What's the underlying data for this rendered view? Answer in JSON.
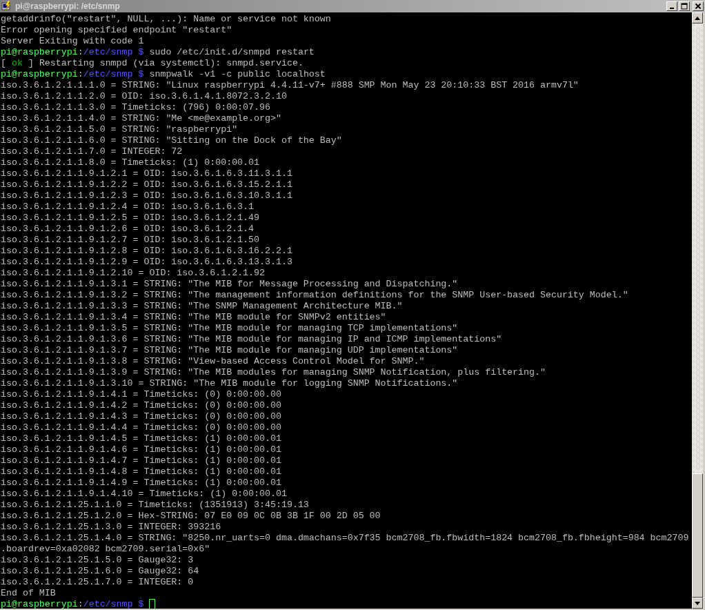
{
  "window": {
    "title": "pi@raspberrypi: /etc/snmp"
  },
  "lines": [
    {
      "segments": [
        {
          "kind": "text",
          "text": "getaddrinfo(\"restart\", NULL, ...): Name or service not known"
        }
      ]
    },
    {
      "segments": [
        {
          "kind": "text",
          "text": "Error opening specified endpoint \"restart\""
        }
      ]
    },
    {
      "segments": [
        {
          "kind": "text",
          "text": "Server Exiting with code 1"
        }
      ]
    },
    {
      "segments": [
        {
          "kind": "user",
          "text": "pi@raspberrypi"
        },
        {
          "kind": "text",
          "text": ":"
        },
        {
          "kind": "path",
          "text": "/etc/snmp $"
        },
        {
          "kind": "text",
          "text": " sudo /etc/init.d/snmpd restart"
        }
      ]
    },
    {
      "segments": [
        {
          "kind": "text",
          "text": "[ "
        },
        {
          "kind": "ok",
          "text": "ok"
        },
        {
          "kind": "text",
          "text": " ] Restarting snmpd (via systemctl): snmpd.service."
        }
      ]
    },
    {
      "segments": [
        {
          "kind": "user",
          "text": "pi@raspberrypi"
        },
        {
          "kind": "text",
          "text": ":"
        },
        {
          "kind": "path",
          "text": "/etc/snmp $"
        },
        {
          "kind": "text",
          "text": " snmpwalk -v1 -c public localhost"
        }
      ]
    },
    {
      "segments": [
        {
          "kind": "text",
          "text": "iso.3.6.1.2.1.1.1.0 = STRING: \"Linux raspberrypi 4.4.11-v7+ #888 SMP Mon May 23 20:10:33 BST 2016 armv7l\""
        }
      ]
    },
    {
      "segments": [
        {
          "kind": "text",
          "text": "iso.3.6.1.2.1.1.2.0 = OID: iso.3.6.1.4.1.8072.3.2.10"
        }
      ]
    },
    {
      "segments": [
        {
          "kind": "text",
          "text": "iso.3.6.1.2.1.1.3.0 = Timeticks: (796) 0:00:07.96"
        }
      ]
    },
    {
      "segments": [
        {
          "kind": "text",
          "text": "iso.3.6.1.2.1.1.4.0 = STRING: \"Me <me@example.org>\""
        }
      ]
    },
    {
      "segments": [
        {
          "kind": "text",
          "text": "iso.3.6.1.2.1.1.5.0 = STRING: \"raspberrypi\""
        }
      ]
    },
    {
      "segments": [
        {
          "kind": "text",
          "text": "iso.3.6.1.2.1.1.6.0 = STRING: \"Sitting on the Dock of the Bay\""
        }
      ]
    },
    {
      "segments": [
        {
          "kind": "text",
          "text": "iso.3.6.1.2.1.1.7.0 = INTEGER: 72"
        }
      ]
    },
    {
      "segments": [
        {
          "kind": "text",
          "text": "iso.3.6.1.2.1.1.8.0 = Timeticks: (1) 0:00:00.01"
        }
      ]
    },
    {
      "segments": [
        {
          "kind": "text",
          "text": "iso.3.6.1.2.1.1.9.1.2.1 = OID: iso.3.6.1.6.3.11.3.1.1"
        }
      ]
    },
    {
      "segments": [
        {
          "kind": "text",
          "text": "iso.3.6.1.2.1.1.9.1.2.2 = OID: iso.3.6.1.6.3.15.2.1.1"
        }
      ]
    },
    {
      "segments": [
        {
          "kind": "text",
          "text": "iso.3.6.1.2.1.1.9.1.2.3 = OID: iso.3.6.1.6.3.10.3.1.1"
        }
      ]
    },
    {
      "segments": [
        {
          "kind": "text",
          "text": "iso.3.6.1.2.1.1.9.1.2.4 = OID: iso.3.6.1.6.3.1"
        }
      ]
    },
    {
      "segments": [
        {
          "kind": "text",
          "text": "iso.3.6.1.2.1.1.9.1.2.5 = OID: iso.3.6.1.2.1.49"
        }
      ]
    },
    {
      "segments": [
        {
          "kind": "text",
          "text": "iso.3.6.1.2.1.1.9.1.2.6 = OID: iso.3.6.1.2.1.4"
        }
      ]
    },
    {
      "segments": [
        {
          "kind": "text",
          "text": "iso.3.6.1.2.1.1.9.1.2.7 = OID: iso.3.6.1.2.1.50"
        }
      ]
    },
    {
      "segments": [
        {
          "kind": "text",
          "text": "iso.3.6.1.2.1.1.9.1.2.8 = OID: iso.3.6.1.6.3.16.2.2.1"
        }
      ]
    },
    {
      "segments": [
        {
          "kind": "text",
          "text": "iso.3.6.1.2.1.1.9.1.2.9 = OID: iso.3.6.1.6.3.13.3.1.3"
        }
      ]
    },
    {
      "segments": [
        {
          "kind": "text",
          "text": "iso.3.6.1.2.1.1.9.1.2.10 = OID: iso.3.6.1.2.1.92"
        }
      ]
    },
    {
      "segments": [
        {
          "kind": "text",
          "text": "iso.3.6.1.2.1.1.9.1.3.1 = STRING: \"The MIB for Message Processing and Dispatching.\""
        }
      ]
    },
    {
      "segments": [
        {
          "kind": "text",
          "text": "iso.3.6.1.2.1.1.9.1.3.2 = STRING: \"The management information definitions for the SNMP User-based Security Model.\""
        }
      ]
    },
    {
      "segments": [
        {
          "kind": "text",
          "text": "iso.3.6.1.2.1.1.9.1.3.3 = STRING: \"The SNMP Management Architecture MIB.\""
        }
      ]
    },
    {
      "segments": [
        {
          "kind": "text",
          "text": "iso.3.6.1.2.1.1.9.1.3.4 = STRING: \"The MIB module for SNMPv2 entities\""
        }
      ]
    },
    {
      "segments": [
        {
          "kind": "text",
          "text": "iso.3.6.1.2.1.1.9.1.3.5 = STRING: \"The MIB module for managing TCP implementations\""
        }
      ]
    },
    {
      "segments": [
        {
          "kind": "text",
          "text": "iso.3.6.1.2.1.1.9.1.3.6 = STRING: \"The MIB module for managing IP and ICMP implementations\""
        }
      ]
    },
    {
      "segments": [
        {
          "kind": "text",
          "text": "iso.3.6.1.2.1.1.9.1.3.7 = STRING: \"The MIB module for managing UDP implementations\""
        }
      ]
    },
    {
      "segments": [
        {
          "kind": "text",
          "text": "iso.3.6.1.2.1.1.9.1.3.8 = STRING: \"View-based Access Control Model for SNMP.\""
        }
      ]
    },
    {
      "segments": [
        {
          "kind": "text",
          "text": "iso.3.6.1.2.1.1.9.1.3.9 = STRING: \"The MIB modules for managing SNMP Notification, plus filtering.\""
        }
      ]
    },
    {
      "segments": [
        {
          "kind": "text",
          "text": "iso.3.6.1.2.1.1.9.1.3.10 = STRING: \"The MIB module for logging SNMP Notifications.\""
        }
      ]
    },
    {
      "segments": [
        {
          "kind": "text",
          "text": "iso.3.6.1.2.1.1.9.1.4.1 = Timeticks: (0) 0:00:00.00"
        }
      ]
    },
    {
      "segments": [
        {
          "kind": "text",
          "text": "iso.3.6.1.2.1.1.9.1.4.2 = Timeticks: (0) 0:00:00.00"
        }
      ]
    },
    {
      "segments": [
        {
          "kind": "text",
          "text": "iso.3.6.1.2.1.1.9.1.4.3 = Timeticks: (0) 0:00:00.00"
        }
      ]
    },
    {
      "segments": [
        {
          "kind": "text",
          "text": "iso.3.6.1.2.1.1.9.1.4.4 = Timeticks: (0) 0:00:00.00"
        }
      ]
    },
    {
      "segments": [
        {
          "kind": "text",
          "text": "iso.3.6.1.2.1.1.9.1.4.5 = Timeticks: (1) 0:00:00.01"
        }
      ]
    },
    {
      "segments": [
        {
          "kind": "text",
          "text": "iso.3.6.1.2.1.1.9.1.4.6 = Timeticks: (1) 0:00:00.01"
        }
      ]
    },
    {
      "segments": [
        {
          "kind": "text",
          "text": "iso.3.6.1.2.1.1.9.1.4.7 = Timeticks: (1) 0:00:00.01"
        }
      ]
    },
    {
      "segments": [
        {
          "kind": "text",
          "text": "iso.3.6.1.2.1.1.9.1.4.8 = Timeticks: (1) 0:00:00.01"
        }
      ]
    },
    {
      "segments": [
        {
          "kind": "text",
          "text": "iso.3.6.1.2.1.1.9.1.4.9 = Timeticks: (1) 0:00:00.01"
        }
      ]
    },
    {
      "segments": [
        {
          "kind": "text",
          "text": "iso.3.6.1.2.1.1.9.1.4.10 = Timeticks: (1) 0:00:00.01"
        }
      ]
    },
    {
      "segments": [
        {
          "kind": "text",
          "text": "iso.3.6.1.2.1.25.1.1.0 = Timeticks: (1351913) 3:45:19.13"
        }
      ]
    },
    {
      "segments": [
        {
          "kind": "text",
          "text": "iso.3.6.1.2.1.25.1.2.0 = Hex-STRING: 07 E0 09 0C 0B 3B 1F 00 2D 05 00"
        }
      ]
    },
    {
      "segments": [
        {
          "kind": "text",
          "text": "iso.3.6.1.2.1.25.1.3.0 = INTEGER: 393216"
        }
      ]
    },
    {
      "segments": [
        {
          "kind": "text",
          "text": "iso.3.6.1.2.1.25.1.4.0 = STRING: \"8250.nr_uarts=0 dma.dmachans=0x7f35 bcm2708_fb.fbwidth=1824 bcm2708_fb.fbheight=984 bcm2709"
        }
      ]
    },
    {
      "segments": [
        {
          "kind": "text",
          "text": ".boardrev=0xa02082 bcm2709.serial=0x6\""
        }
      ]
    },
    {
      "segments": [
        {
          "kind": "text",
          "text": "iso.3.6.1.2.1.25.1.5.0 = Gauge32: 3"
        }
      ]
    },
    {
      "segments": [
        {
          "kind": "text",
          "text": "iso.3.6.1.2.1.25.1.6.0 = Gauge32: 64"
        }
      ]
    },
    {
      "segments": [
        {
          "kind": "text",
          "text": "iso.3.6.1.2.1.25.1.7.0 = INTEGER: 0"
        }
      ]
    },
    {
      "segments": [
        {
          "kind": "text",
          "text": "End of MIB"
        }
      ]
    },
    {
      "segments": [
        {
          "kind": "user",
          "text": "pi@raspberrypi"
        },
        {
          "kind": "text",
          "text": ":"
        },
        {
          "kind": "path",
          "text": "/etc/snmp $"
        }
      ],
      "cursor": true
    }
  ]
}
